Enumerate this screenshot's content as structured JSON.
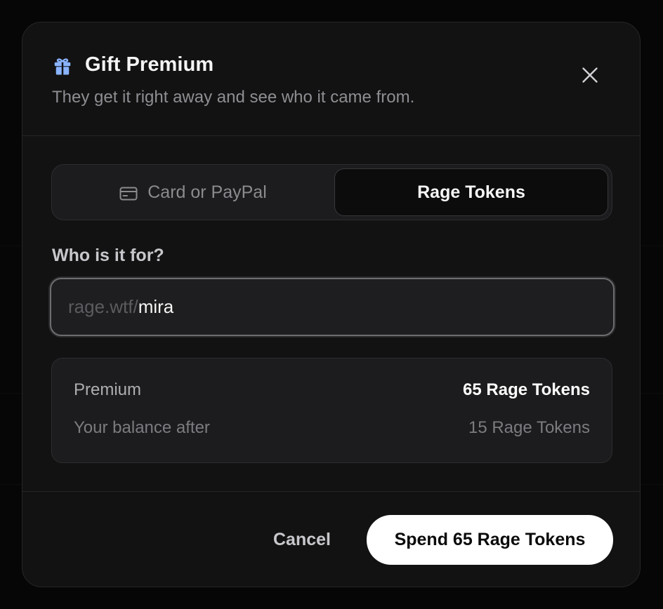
{
  "dialog": {
    "title": "Gift Premium",
    "subtitle": "They get it right away and see who it came from.",
    "icons": {
      "header": "gift-icon",
      "close": "close-icon",
      "card_tab": "credit-card-icon"
    }
  },
  "payment_tabs": {
    "items": [
      {
        "label": "Card or PayPal",
        "selected": false
      },
      {
        "label": "Rage Tokens",
        "selected": true
      }
    ]
  },
  "recipient": {
    "label": "Who is it for?",
    "prefix": "rage.wtf/",
    "value": "mira"
  },
  "summary": {
    "premium_label": "Premium",
    "premium_value": "65 Rage Tokens",
    "balance_label": "Your balance after",
    "balance_value": "15 Rage Tokens"
  },
  "footer": {
    "cancel_label": "Cancel",
    "confirm_label": "Spend 65 Rage Tokens"
  },
  "colors": {
    "modal_background": "#121212",
    "accent_icon": "#8ab4ff",
    "primary_button": "#ffffff"
  }
}
